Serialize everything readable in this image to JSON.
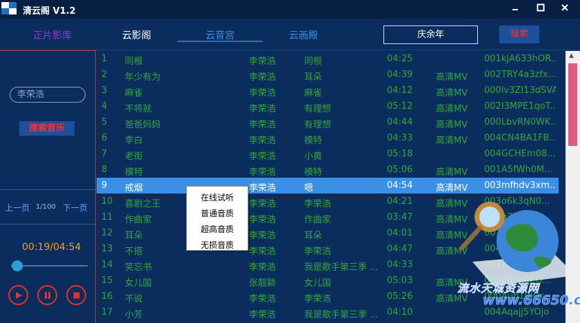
{
  "window": {
    "title": "清云阁 V1.2",
    "minimize": "▬",
    "maximize": "□",
    "close": "✕"
  },
  "nav": {
    "tabs": [
      {
        "label": "正片影库",
        "color": "#8a3fd6"
      },
      {
        "label": "云影阁",
        "color": "#ffffff"
      },
      {
        "label": "云音宫",
        "color": "#3a8fe6"
      },
      {
        "label": "云画殿",
        "color": "#3a8fe6"
      }
    ],
    "active_tab": "云音宫",
    "search_value": "庆余年",
    "search_button": "搜索"
  },
  "sidebar": {
    "search_value": "李荣浩",
    "search_button": "搜索音乐",
    "prev_page": "上一页",
    "page_count": "1/100",
    "next_page": "下一页",
    "time": "00:19/04:54",
    "progress": 0.03
  },
  "songs": [
    {
      "num": "1",
      "title": "同根",
      "artist": "李荣浩",
      "album": "同根",
      "duration": "04:25",
      "mv": "",
      "id": "001kjA633hOR..."
    },
    {
      "num": "2",
      "title": "年少有为",
      "artist": "李荣浩",
      "album": "耳朵",
      "duration": "04:39",
      "mv": "高清MV",
      "id": "002TRY4a3zfx..."
    },
    {
      "num": "3",
      "title": "麻雀",
      "artist": "李荣浩",
      "album": "麻雀",
      "duration": "04:12",
      "mv": "高清MV",
      "id": "000lv3ZI13dSVA"
    },
    {
      "num": "4",
      "title": "不将就",
      "artist": "李荣浩",
      "album": "有理想",
      "duration": "05:12",
      "mv": "高清MV",
      "id": "002I3MPE1qoT..."
    },
    {
      "num": "5",
      "title": "爸爸妈妈",
      "artist": "李荣浩",
      "album": "有理想",
      "duration": "04:44",
      "mv": "高清MV",
      "id": "000LbvRN0WK..."
    },
    {
      "num": "6",
      "title": "李白",
      "artist": "李荣浩",
      "album": "模特",
      "duration": "04:33",
      "mv": "高清MV",
      "id": "004CN4BA1FB..."
    },
    {
      "num": "7",
      "title": "老街",
      "artist": "李荣浩",
      "album": "小黄",
      "duration": "05:18",
      "mv": "",
      "id": "004GCHEm08..."
    },
    {
      "num": "8",
      "title": "模特",
      "artist": "李荣浩",
      "album": "模特",
      "duration": "05:06",
      "mv": "高清MV",
      "id": "001A5fWh0M..."
    },
    {
      "num": "9",
      "title": "戒烟",
      "artist": "李荣浩",
      "album": "嗯",
      "duration": "04:54",
      "mv": "高清MV",
      "id": "003mfhdv3xm..."
    },
    {
      "num": "10",
      "title": "喜剧之王",
      "artist": "李荣浩",
      "album": "李荣浩",
      "duration": "04:21",
      "mv": "高清MV",
      "id": "003o6k3qN0..."
    },
    {
      "num": "11",
      "title": "作曲家",
      "artist": "李荣浩",
      "album": "作曲家",
      "duration": "03:47",
      "mv": "高清MV",
      "id": "002q3PJAX..."
    },
    {
      "num": "12",
      "title": "耳朵",
      "artist": "李荣浩",
      "album": "耳朵",
      "duration": "04:01",
      "mv": "高清MV",
      "id": "001UzSk4..."
    },
    {
      "num": "13",
      "title": "不搭",
      "artist": "李荣浩",
      "album": "李荣浩",
      "duration": "04:47",
      "mv": "高清MV",
      "id": "004TaqvM..."
    },
    {
      "num": "14",
      "title": "笑忘书",
      "artist": "李荣浩",
      "album": "我是歌手第三季 ...",
      "duration": "04:33",
      "mv": "",
      "id": "001ZlF..."
    },
    {
      "num": "15",
      "title": "女儿国",
      "artist": "张靓颖",
      "album": "女儿国",
      "duration": "05:03",
      "mv": "高清MV",
      "id": "002080n9EQ..."
    },
    {
      "num": "16",
      "title": "不说",
      "artist": "李荣浩",
      "album": "李荣浩",
      "duration": "05:26",
      "mv": "高清MV",
      "id": "000Aub10JOr..."
    },
    {
      "num": "17",
      "title": "小芳",
      "artist": "李荣浩",
      "album": "我是歌手第三季 ...",
      "duration": "04:10",
      "mv": "",
      "id": "004Aqajj5YOjo"
    }
  ],
  "selected_index": 8,
  "context_menu": [
    "在线试听",
    "普通音质",
    "超高音质",
    "无损音质"
  ],
  "watermark": {
    "line1": "流水天城资源网",
    "line2": "www.66650.com"
  },
  "colors": {
    "background": "#0b2d5e",
    "row_text": "#2fa83a",
    "selected_row": "#3a8fe6",
    "accent_red": "#e0332a",
    "time_orange": "#ff9f1a",
    "scroll_thumb": "#e35a85"
  }
}
